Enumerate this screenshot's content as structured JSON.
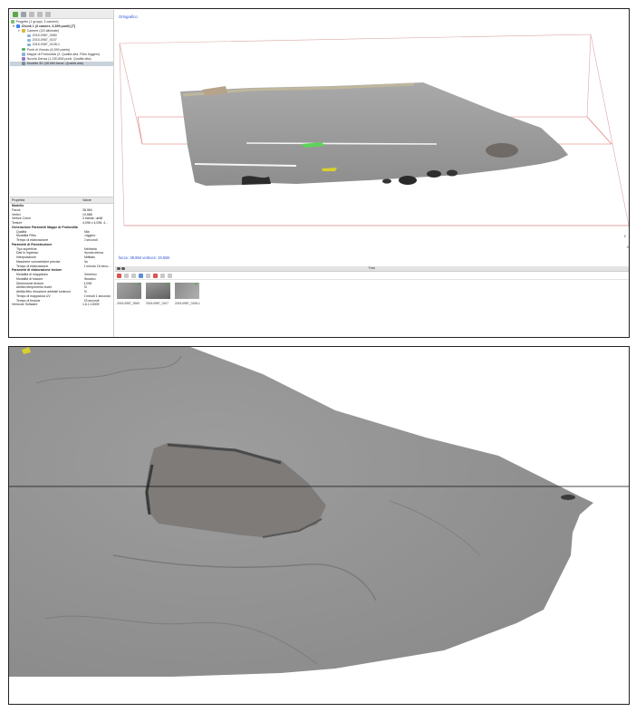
{
  "tree": {
    "project": "Progetto (1 gruppi, 3 camere)",
    "chunk": "Chunk 1 (3 camere, 6,399 punti) [T]",
    "cameras": "Camere (3/3 allineate)",
    "camera_items": [
      "2015-0987_0060",
      "2015-0987_0107",
      "2015-0987_0108-1"
    ],
    "tie_points": "Punti di Vincolo (6,399 points)",
    "depth_maps": "Mappe di Profondità (3, Qualità alta, Filtro leggero)",
    "dense_cloud": "Nuvola Densa (1,230,808 punti, Qualità alta)",
    "model": "Modello 3D (38,984 facce, Qualità alta)"
  },
  "properties": {
    "header": {
      "key": "Proprietà",
      "value": "Valore"
    },
    "rows": [
      {
        "k": "Modello",
        "v": "",
        "type": "sec"
      },
      {
        "k": "Facce",
        "v": "38,984",
        "type": "norm"
      },
      {
        "k": "Vertici",
        "v": "19,588",
        "type": "norm"
      },
      {
        "k": "Vertice Colori",
        "v": "3 bande, uint8",
        "type": "norm"
      },
      {
        "k": "Texture",
        "v": "4,096 x 4,096, 4...",
        "type": "norm"
      },
      {
        "k": "Generazione Parametri Mappe di Profondità",
        "v": "",
        "type": "sec"
      },
      {
        "k": "Qualità",
        "v": "Alta",
        "type": "ind"
      },
      {
        "k": "Modalità Filtro",
        "v": "Leggero",
        "type": "ind"
      },
      {
        "k": "Tempo di elaborazione",
        "v": "0 secondi",
        "type": "ind"
      },
      {
        "k": "Parametri di Ricostruzione",
        "v": "",
        "type": "sec"
      },
      {
        "k": "Tipo superficie",
        "v": "Arbitraria",
        "type": "ind"
      },
      {
        "k": "Dati in Ingresso",
        "v": "Nuvola densa",
        "type": "ind"
      },
      {
        "k": "Interpolazione",
        "v": "Abilitato",
        "type": "ind"
      },
      {
        "k": "Maschere volumetriche precise",
        "v": "No",
        "type": "ind"
      },
      {
        "k": "Tempo di elaborazione",
        "v": "1 minuto 16 seco...",
        "type": "ind"
      },
      {
        "k": "Parametri di elaborazione texture",
        "v": "",
        "type": "sec"
      },
      {
        "k": "Modalità di mappatura",
        "v": "Generico",
        "type": "ind"
      },
      {
        "k": "Modalità di fusione",
        "v": "Mosaico",
        "type": "ind"
      },
      {
        "k": "Dimensione texture",
        "v": "4,096",
        "type": "ind"
      },
      {
        "k": "Abilita riempimento buchi",
        "v": "Sì",
        "type": "ind"
      },
      {
        "k": "Abilita filtro rimozione artefatti luminosi",
        "v": "Sì",
        "type": "ind"
      },
      {
        "k": "Tempo di mappatura UV",
        "v": "2 minuti 1 secondo",
        "type": "ind"
      },
      {
        "k": "Tempo di fusione",
        "v": "33 secondi",
        "type": "ind"
      },
      {
        "k": "Versione Software",
        "v": "1.6.1.10009",
        "type": "norm"
      }
    ]
  },
  "viewport": {
    "mode": "Ortografico",
    "stats": "facce: 38,984 vertices: 19,588",
    "axis_z": "Z",
    "axis_x": "X"
  },
  "photos": {
    "title": "Foto",
    "items": [
      {
        "caption": "2015-0987_0060"
      },
      {
        "caption": "2015-0987_0107"
      },
      {
        "caption": "2015-0987_0108-1"
      }
    ]
  }
}
